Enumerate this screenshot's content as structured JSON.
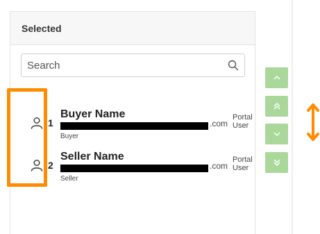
{
  "panel": {
    "title": "Selected",
    "search": {
      "placeholder": "Search",
      "value": ""
    }
  },
  "rows": [
    {
      "index": "1",
      "name": "Buyer Name",
      "email_domain": ".com",
      "role": "Buyer",
      "user_type": "Portal User",
      "icon": "person-icon"
    },
    {
      "index": "2",
      "name": "Seller Name",
      "email_domain": ".com",
      "role": "Seller",
      "user_type": "Portal User",
      "icon": "person-icon"
    }
  ],
  "controls": [
    {
      "name": "move-up",
      "icon": "chevron-up-icon"
    },
    {
      "name": "move-to-top",
      "icon": "double-chevron-up-icon"
    },
    {
      "name": "move-down",
      "icon": "chevron-down-icon"
    },
    {
      "name": "move-to-bottom",
      "icon": "double-chevron-down-icon"
    }
  ],
  "colors": {
    "control_green": "#a9d89a",
    "highlight_orange": "#ff8c00"
  }
}
